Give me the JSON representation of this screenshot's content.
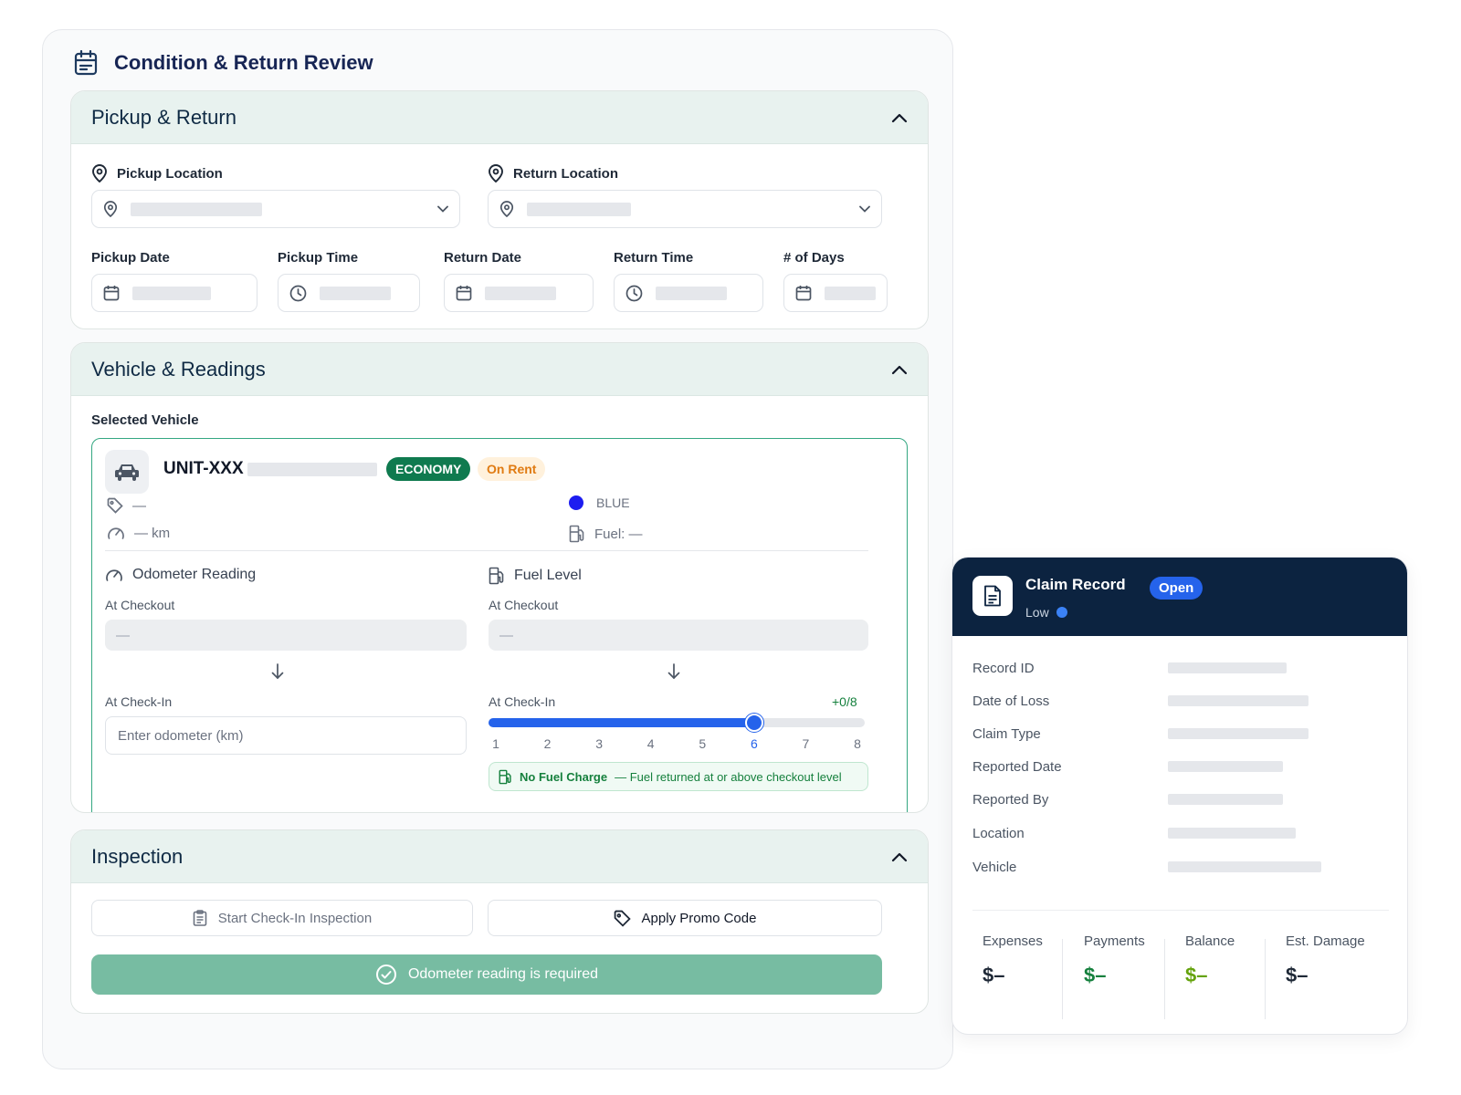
{
  "page": {
    "title": "Condition & Return Review",
    "title_icon": "calendar-check-icon"
  },
  "colors": {
    "accent_green": "#0f7a4f",
    "header_navy": "#0c2340",
    "section_bg": "#e8f2ef",
    "slider_blue": "#2563eb",
    "primary_button": "#77bca2"
  },
  "pickup_return": {
    "title": "Pickup & Return",
    "pickup_location_label": "Pickup Location",
    "return_location_label": "Return Location",
    "pickup_date_label": "Pickup Date",
    "pickup_time_label": "Pickup Time",
    "return_date_label": "Return Date",
    "return_time_label": "Return Time",
    "days_label": "# of Days"
  },
  "vehicle": {
    "title": "Vehicle & Readings",
    "selected_label": "Selected Vehicle",
    "unit": "UNIT-XXX",
    "class_badge": "ECONOMY",
    "status_badge": "On Rent",
    "plate": "—",
    "mileage": "— km",
    "color_name": "BLUE",
    "color_swatch": "#1d1df0",
    "fuel": "Fuel: —",
    "odometer": {
      "heading": "Odometer Reading",
      "checkout_label": "At Checkout",
      "checkout_value": "—",
      "checkin_label": "At Check-In",
      "checkin_placeholder": "Enter odometer (km)"
    },
    "fuel_level": {
      "heading": "Fuel Level",
      "checkout_label": "At Checkout",
      "checkout_value": "—",
      "checkin_label": "At Check-In",
      "delta": "+0/8",
      "scale": [
        "1",
        "2",
        "3",
        "4",
        "5",
        "6",
        "7",
        "8"
      ],
      "selected": 6,
      "max": 8,
      "notice_strong": "No Fuel Charge",
      "notice_text": "— Fuel returned at or above checkout level"
    }
  },
  "inspection": {
    "title": "Inspection",
    "start_button": "Start Check-In Inspection",
    "promo_button": "Apply Promo Code",
    "submit_button": "Odometer reading is required"
  },
  "claim": {
    "title": "Claim Record",
    "status": "Open",
    "priority": "Low",
    "rows": [
      "Record ID",
      "Date of Loss",
      "Claim Type",
      "Reported Date",
      "Reported By",
      "Location",
      "Vehicle"
    ],
    "financials": [
      {
        "label": "Expenses",
        "value": "$–",
        "color": "#1f2937"
      },
      {
        "label": "Payments",
        "value": "$–",
        "color": "#15803d"
      },
      {
        "label": "Balance",
        "value": "$–",
        "color": "#65a30d"
      },
      {
        "label": "Est. Damage",
        "value": "$–",
        "color": "#1f2937"
      }
    ]
  }
}
